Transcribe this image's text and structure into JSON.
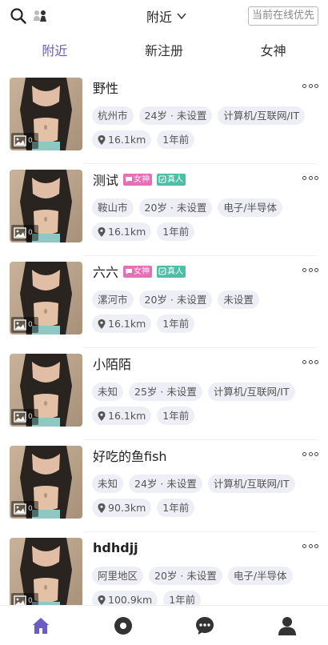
{
  "header": {
    "title": "附近",
    "online_priority": "当前在线优先"
  },
  "tabs": [
    {
      "label": "附近",
      "active": true
    },
    {
      "label": "新注册",
      "active": false
    },
    {
      "label": "女神",
      "active": false
    }
  ],
  "badges": {
    "goddess": "女神",
    "real": "真人"
  },
  "users": [
    {
      "name": "野性",
      "bold": false,
      "goddess": false,
      "real": false,
      "tags": [
        "杭州市",
        "24岁 · 未设置",
        "计算机/互联网/IT"
      ],
      "distance": "16.1km",
      "time": "1年前",
      "photo_count": "0"
    },
    {
      "name": "测试",
      "bold": false,
      "goddess": true,
      "real": true,
      "tags": [
        "鞍山市",
        "20岁 · 未设置",
        "电子/半导体"
      ],
      "distance": "16.1km",
      "time": "1年前",
      "photo_count": "0"
    },
    {
      "name": "六六",
      "bold": false,
      "goddess": true,
      "real": true,
      "tags": [
        "漯河市",
        "20岁 · 未设置",
        "未设置"
      ],
      "distance": "16.1km",
      "time": "1年前",
      "photo_count": "0"
    },
    {
      "name": "小陌陌",
      "bold": false,
      "goddess": false,
      "real": false,
      "tags": [
        "未知",
        "25岁 · 未设置",
        "计算机/互联网/IT"
      ],
      "distance": "16.1km",
      "time": "1年前",
      "photo_count": "0"
    },
    {
      "name": "好吃的鱼fish",
      "bold": false,
      "goddess": false,
      "real": false,
      "tags": [
        "未知",
        "24岁 · 未设置",
        "计算机/互联网/IT"
      ],
      "distance": "90.3km",
      "time": "1年前",
      "photo_count": "0"
    },
    {
      "name": "hdhdjj",
      "bold": true,
      "goddess": false,
      "real": false,
      "tags": [
        "阿里地区",
        "20岁 · 未设置",
        "电子/半导体"
      ],
      "distance": "100.9km",
      "time": "1年前",
      "photo_count": "0"
    }
  ],
  "bottom_nav": [
    {
      "icon": "home-icon",
      "active": true
    },
    {
      "icon": "discover-icon",
      "active": false
    },
    {
      "icon": "message-icon",
      "active": false
    },
    {
      "icon": "profile-icon",
      "active": false
    }
  ],
  "colors": {
    "accent": "#6b5bc5",
    "chip_bg": "#eeeef6",
    "goddess": "#e86fb6",
    "real": "#4ebfa6"
  }
}
